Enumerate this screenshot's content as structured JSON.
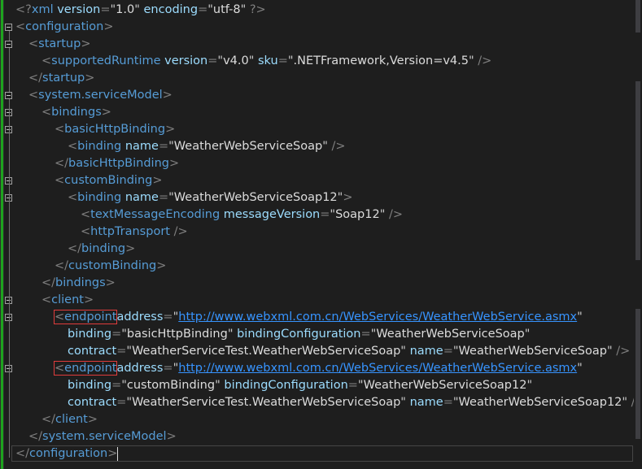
{
  "editor": {
    "lines": [
      {
        "indent": 0,
        "tokens": [
          [
            "d",
            "<?"
          ],
          [
            "t",
            "xml"
          ],
          [
            "a",
            " version"
          ],
          [
            "d",
            "="
          ],
          [
            "q",
            "\""
          ],
          [
            "v",
            "1.0"
          ],
          [
            "q",
            "\""
          ],
          [
            "a",
            " encoding"
          ],
          [
            "d",
            "="
          ],
          [
            "q",
            "\""
          ],
          [
            "v",
            "utf-8"
          ],
          [
            "q",
            "\""
          ],
          [
            "d",
            " ?>"
          ]
        ]
      },
      {
        "indent": 0,
        "tokens": [
          [
            "d",
            "<"
          ],
          [
            "t",
            "configuration"
          ],
          [
            "d",
            ">"
          ]
        ]
      },
      {
        "indent": 1,
        "tokens": [
          [
            "d",
            "<"
          ],
          [
            "t",
            "startup"
          ],
          [
            "d",
            ">"
          ]
        ]
      },
      {
        "indent": 2,
        "tokens": [
          [
            "d",
            "<"
          ],
          [
            "t",
            "supportedRuntime"
          ],
          [
            "a",
            " version"
          ],
          [
            "d",
            "="
          ],
          [
            "q",
            "\""
          ],
          [
            "v",
            "v4.0"
          ],
          [
            "q",
            "\""
          ],
          [
            "a",
            " sku"
          ],
          [
            "d",
            "="
          ],
          [
            "q",
            "\""
          ],
          [
            "v",
            ".NETFramework,Version=v4.5"
          ],
          [
            "q",
            "\""
          ],
          [
            "d",
            " />"
          ]
        ]
      },
      {
        "indent": 1,
        "tokens": [
          [
            "d",
            "</"
          ],
          [
            "t",
            "startup"
          ],
          [
            "d",
            ">"
          ]
        ]
      },
      {
        "indent": 1,
        "tokens": [
          [
            "d",
            "<"
          ],
          [
            "t",
            "system.serviceModel"
          ],
          [
            "d",
            ">"
          ]
        ]
      },
      {
        "indent": 2,
        "tokens": [
          [
            "d",
            "<"
          ],
          [
            "t",
            "bindings"
          ],
          [
            "d",
            ">"
          ]
        ]
      },
      {
        "indent": 3,
        "tokens": [
          [
            "d",
            "<"
          ],
          [
            "t",
            "basicHttpBinding"
          ],
          [
            "d",
            ">"
          ]
        ]
      },
      {
        "indent": 4,
        "tokens": [
          [
            "d",
            "<"
          ],
          [
            "t",
            "binding"
          ],
          [
            "a",
            " name"
          ],
          [
            "d",
            "="
          ],
          [
            "q",
            "\""
          ],
          [
            "v",
            "WeatherWebServiceSoap"
          ],
          [
            "q",
            "\""
          ],
          [
            "d",
            " />"
          ]
        ]
      },
      {
        "indent": 3,
        "tokens": [
          [
            "d",
            "</"
          ],
          [
            "t",
            "basicHttpBinding"
          ],
          [
            "d",
            ">"
          ]
        ]
      },
      {
        "indent": 3,
        "tokens": [
          [
            "d",
            "<"
          ],
          [
            "t",
            "customBinding"
          ],
          [
            "d",
            ">"
          ]
        ]
      },
      {
        "indent": 4,
        "tokens": [
          [
            "d",
            "<"
          ],
          [
            "t",
            "binding"
          ],
          [
            "a",
            " name"
          ],
          [
            "d",
            "="
          ],
          [
            "q",
            "\""
          ],
          [
            "v",
            "WeatherWebServiceSoap12"
          ],
          [
            "q",
            "\""
          ],
          [
            "d",
            ">"
          ]
        ]
      },
      {
        "indent": 5,
        "tokens": [
          [
            "d",
            "<"
          ],
          [
            "t",
            "textMessageEncoding"
          ],
          [
            "a",
            " messageVersion"
          ],
          [
            "d",
            "="
          ],
          [
            "q",
            "\""
          ],
          [
            "v",
            "Soap12"
          ],
          [
            "q",
            "\""
          ],
          [
            "d",
            " />"
          ]
        ]
      },
      {
        "indent": 5,
        "tokens": [
          [
            "d",
            "<"
          ],
          [
            "t",
            "httpTransport"
          ],
          [
            "d",
            " />"
          ]
        ]
      },
      {
        "indent": 4,
        "tokens": [
          [
            "d",
            "</"
          ],
          [
            "t",
            "binding"
          ],
          [
            "d",
            ">"
          ]
        ]
      },
      {
        "indent": 3,
        "tokens": [
          [
            "d",
            "</"
          ],
          [
            "t",
            "customBinding"
          ],
          [
            "d",
            ">"
          ]
        ]
      },
      {
        "indent": 2,
        "tokens": [
          [
            "d",
            "</"
          ],
          [
            "t",
            "bindings"
          ],
          [
            "d",
            ">"
          ]
        ]
      },
      {
        "indent": 2,
        "tokens": [
          [
            "d",
            "<"
          ],
          [
            "t",
            "client"
          ],
          [
            "d",
            ">"
          ]
        ]
      },
      {
        "indent": 3,
        "boxed": true,
        "tokens": [
          [
            "d",
            "<"
          ],
          [
            "t",
            "endpoint"
          ],
          [
            "a",
            "address"
          ],
          [
            "d",
            "="
          ],
          [
            "q",
            "\""
          ],
          [
            "u",
            "http://www.webxml.com.cn/WebServices/WeatherWebService.asmx"
          ],
          [
            "q",
            "\""
          ]
        ]
      },
      {
        "indent": 4,
        "tokens": [
          [
            "a",
            "binding"
          ],
          [
            "d",
            "="
          ],
          [
            "q",
            "\""
          ],
          [
            "v",
            "basicHttpBinding"
          ],
          [
            "q",
            "\""
          ],
          [
            "a",
            " bindingConfiguration"
          ],
          [
            "d",
            "="
          ],
          [
            "q",
            "\""
          ],
          [
            "v",
            "WeatherWebServiceSoap"
          ],
          [
            "q",
            "\""
          ]
        ]
      },
      {
        "indent": 4,
        "tokens": [
          [
            "a",
            "contract"
          ],
          [
            "d",
            "="
          ],
          [
            "q",
            "\""
          ],
          [
            "v",
            "WeatherServiceTest.WeatherWebServiceSoap"
          ],
          [
            "q",
            "\""
          ],
          [
            "a",
            " name"
          ],
          [
            "d",
            "="
          ],
          [
            "q",
            "\""
          ],
          [
            "v",
            "WeatherWebServiceSoap"
          ],
          [
            "q",
            "\""
          ],
          [
            "d",
            " />"
          ]
        ]
      },
      {
        "indent": 3,
        "boxed": true,
        "tokens": [
          [
            "d",
            "<"
          ],
          [
            "t",
            "endpoint"
          ],
          [
            "a",
            "address"
          ],
          [
            "d",
            "="
          ],
          [
            "q",
            "\""
          ],
          [
            "u",
            "http://www.webxml.com.cn/WebServices/WeatherWebService.asmx"
          ],
          [
            "q",
            "\""
          ]
        ]
      },
      {
        "indent": 4,
        "tokens": [
          [
            "a",
            "binding"
          ],
          [
            "d",
            "="
          ],
          [
            "q",
            "\""
          ],
          [
            "v",
            "customBinding"
          ],
          [
            "q",
            "\""
          ],
          [
            "a",
            " bindingConfiguration"
          ],
          [
            "d",
            "="
          ],
          [
            "q",
            "\""
          ],
          [
            "v",
            "WeatherWebServiceSoap12"
          ],
          [
            "q",
            "\""
          ]
        ]
      },
      {
        "indent": 4,
        "tokens": [
          [
            "a",
            "contract"
          ],
          [
            "d",
            "="
          ],
          [
            "q",
            "\""
          ],
          [
            "v",
            "WeatherServiceTest.WeatherWebServiceSoap"
          ],
          [
            "q",
            "\""
          ],
          [
            "a",
            " name"
          ],
          [
            "d",
            "="
          ],
          [
            "q",
            "\""
          ],
          [
            "v",
            "WeatherWebServiceSoap12"
          ],
          [
            "q",
            "\""
          ],
          [
            "d",
            " /"
          ]
        ]
      },
      {
        "indent": 2,
        "tokens": [
          [
            "d",
            "</"
          ],
          [
            "t",
            "client"
          ],
          [
            "d",
            ">"
          ]
        ]
      },
      {
        "indent": 1,
        "tokens": [
          [
            "d",
            "</"
          ],
          [
            "t",
            "system.serviceModel"
          ],
          [
            "d",
            ">"
          ]
        ]
      },
      {
        "indent": 0,
        "tokens": [
          [
            "d",
            "</"
          ],
          [
            "t",
            "configuration"
          ],
          [
            "d",
            ">"
          ]
        ]
      }
    ]
  },
  "colors": {
    "background": "#1e1e1e",
    "tag": "#569cd6",
    "attribute": "#9cdcfe",
    "value": "#dcdcdc",
    "delimiter": "#808080",
    "link": "#3794ff",
    "highlight_box": "#e03c3c",
    "saved_change_bar": "#1ea31e"
  }
}
